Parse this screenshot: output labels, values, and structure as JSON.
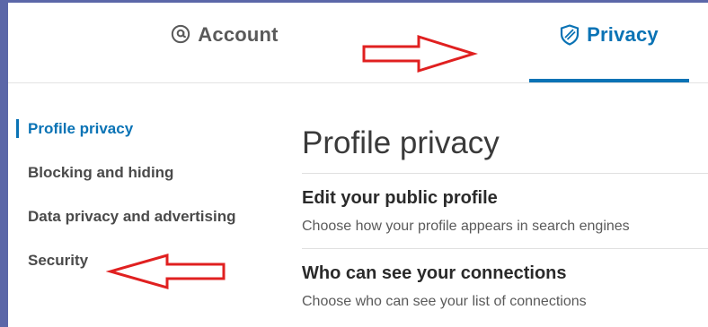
{
  "tabs": {
    "account": {
      "label": "Account",
      "icon": "at-sign-icon"
    },
    "privacy": {
      "label": "Privacy",
      "icon": "shield-icon",
      "active": true
    }
  },
  "colors": {
    "accent": "#0a73b5",
    "frame": "#5b67a8",
    "annotation_arrow": "#e02020"
  },
  "sidebar": {
    "items": [
      {
        "label": "Profile privacy",
        "active": true
      },
      {
        "label": "Blocking and hiding"
      },
      {
        "label": "Data privacy and advertising"
      },
      {
        "label": "Security"
      }
    ]
  },
  "main": {
    "title": "Profile privacy",
    "sections": [
      {
        "heading": "Edit your public profile",
        "description": "Choose how your profile appears in search engines"
      },
      {
        "heading": "Who can see your connections",
        "description": "Choose who can see your list of connections"
      }
    ]
  }
}
